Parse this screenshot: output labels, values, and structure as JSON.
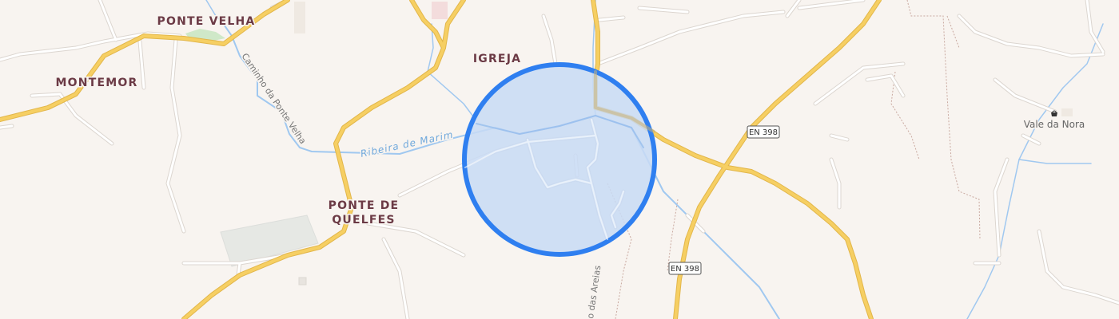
{
  "map": {
    "places": {
      "ponte_velha": "PONTE VELHA",
      "montemor": "MONTEMOR",
      "igreja": "IGREJA",
      "ponte_de_quelfes_line1": "PONTE DE",
      "ponte_de_quelfes_line2": "QUELFES"
    },
    "pois": {
      "vale_da_nora": "Vale da Nora"
    },
    "streets": {
      "caminho_ponte_velha": "Caminho da Ponte Velha",
      "areias": "o das Areias"
    },
    "waterways": {
      "ribeira": "Ribeira de Marim"
    },
    "road_shields": {
      "en398_top": "EN 398",
      "en398_bottom": "EN 398"
    },
    "colors": {
      "background": "#f8f4f0",
      "minor_road": "#ffffff",
      "major_road": "#f6cf63",
      "major_road_casing": "#e2b64a",
      "water": "#a0c8f0",
      "accuracy_fill": "#c8daf5",
      "accuracy_stroke": "#2f7ff0"
    }
  }
}
